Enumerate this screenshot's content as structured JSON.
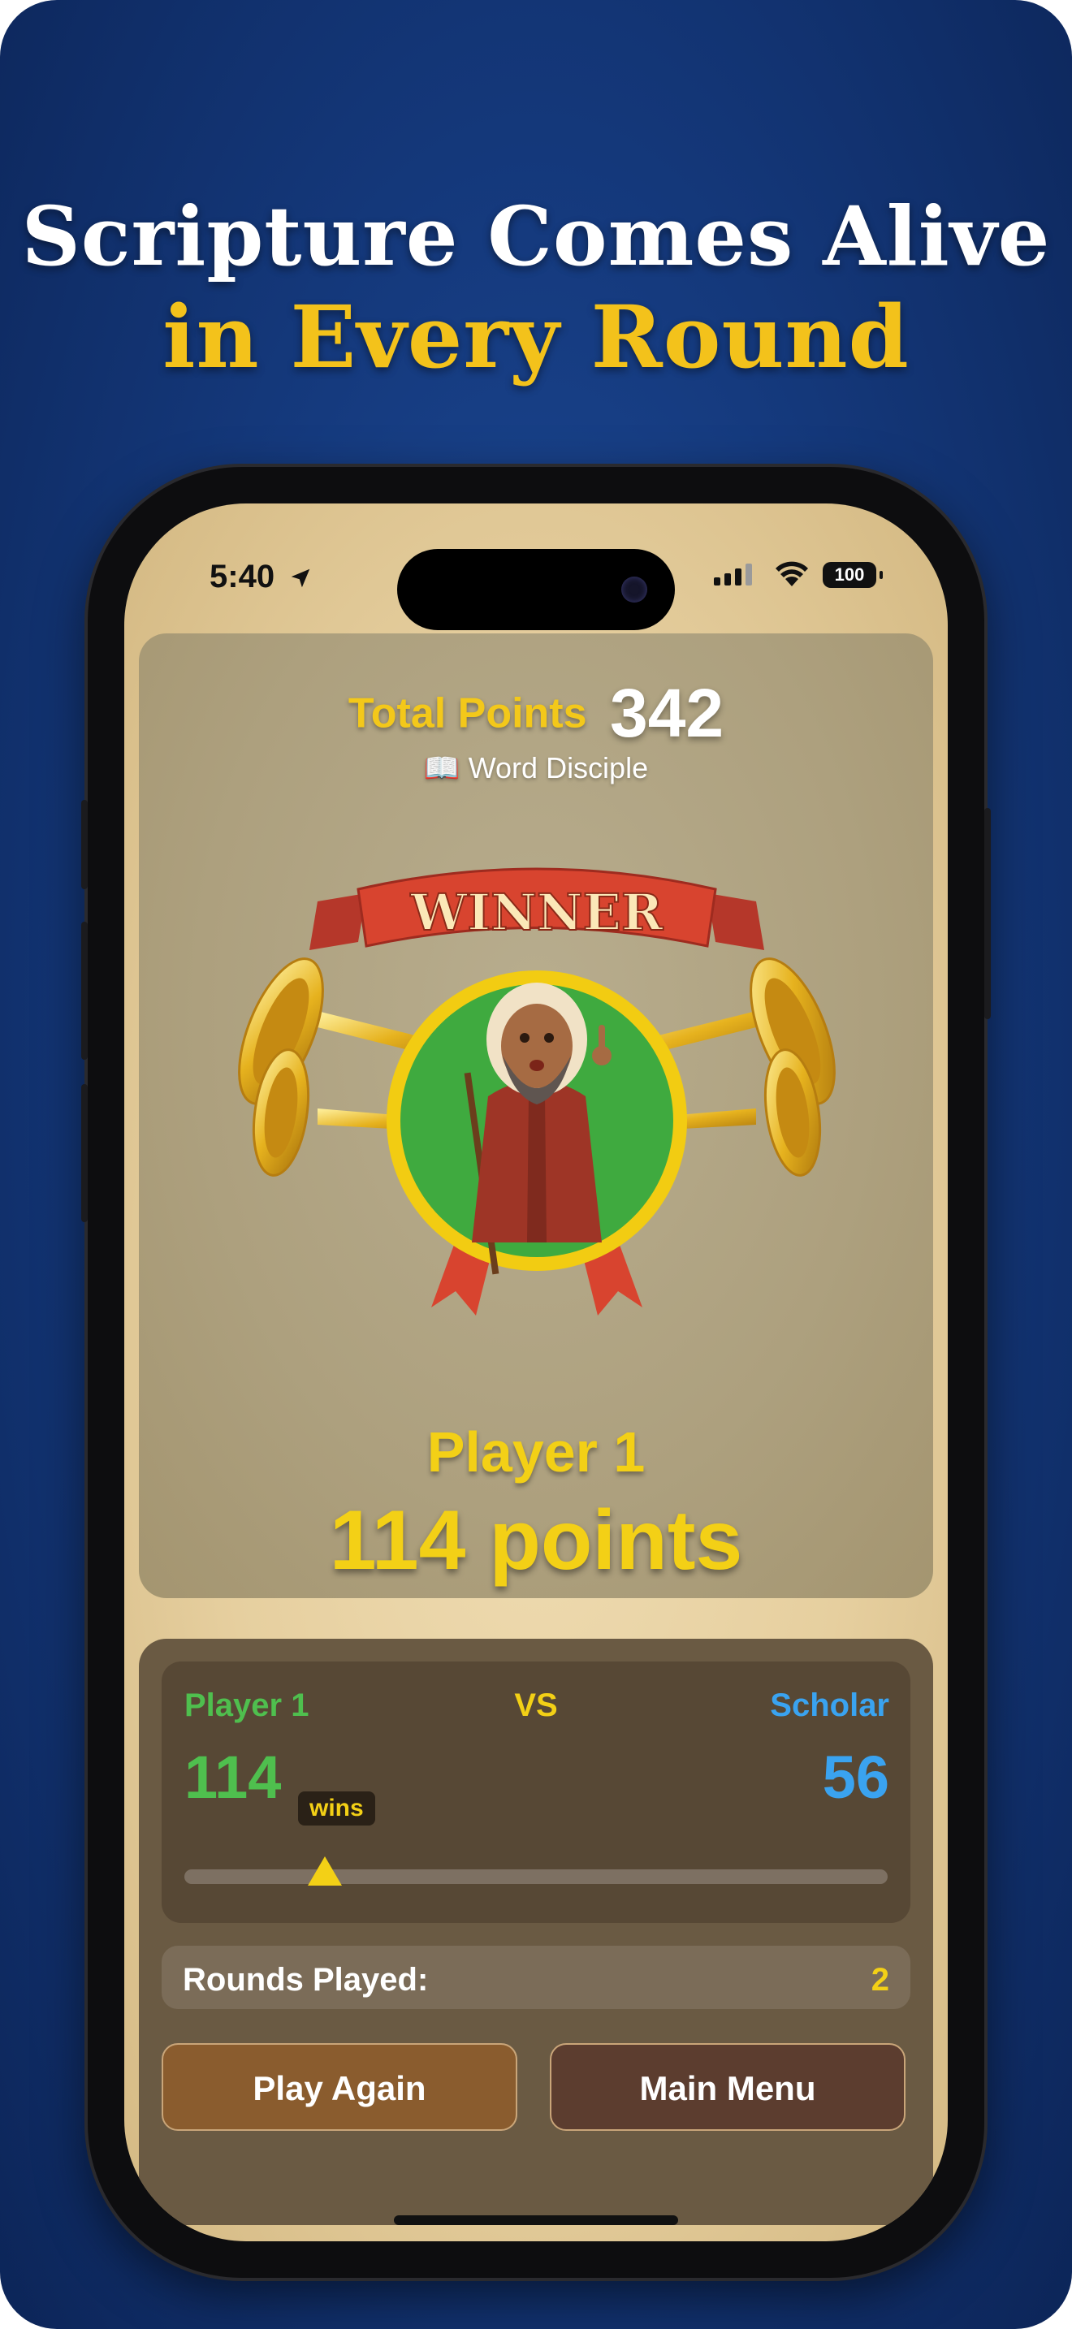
{
  "promo": {
    "line1": "Scripture Comes Alive",
    "line2": "in Every Round"
  },
  "status_bar": {
    "time": "5:40",
    "battery": "100"
  },
  "result": {
    "total_label": "Total Points",
    "total_value": "342",
    "rank_icon": "📖",
    "rank": "Word Disciple",
    "banner_text": "WINNER",
    "winner_name": "Player 1",
    "winner_points": "114 points"
  },
  "versus": {
    "left_name": "Player 1",
    "vs": "VS",
    "right_name": "Scholar",
    "left_score": "114",
    "right_score": "56",
    "wins_label": "wins",
    "marker_fraction": 0.2
  },
  "rounds": {
    "label": "Rounds Played:",
    "value": "2"
  },
  "buttons": {
    "play_again": "Play Again",
    "main_menu": "Main Menu"
  },
  "colors": {
    "background": "#153a7e",
    "accent_yellow": "#f3d016",
    "player_green": "#4fbf4e",
    "scholar_blue": "#3aa3f0",
    "play_button": "#8a5c2e",
    "menu_button": "#5c3d2f"
  }
}
